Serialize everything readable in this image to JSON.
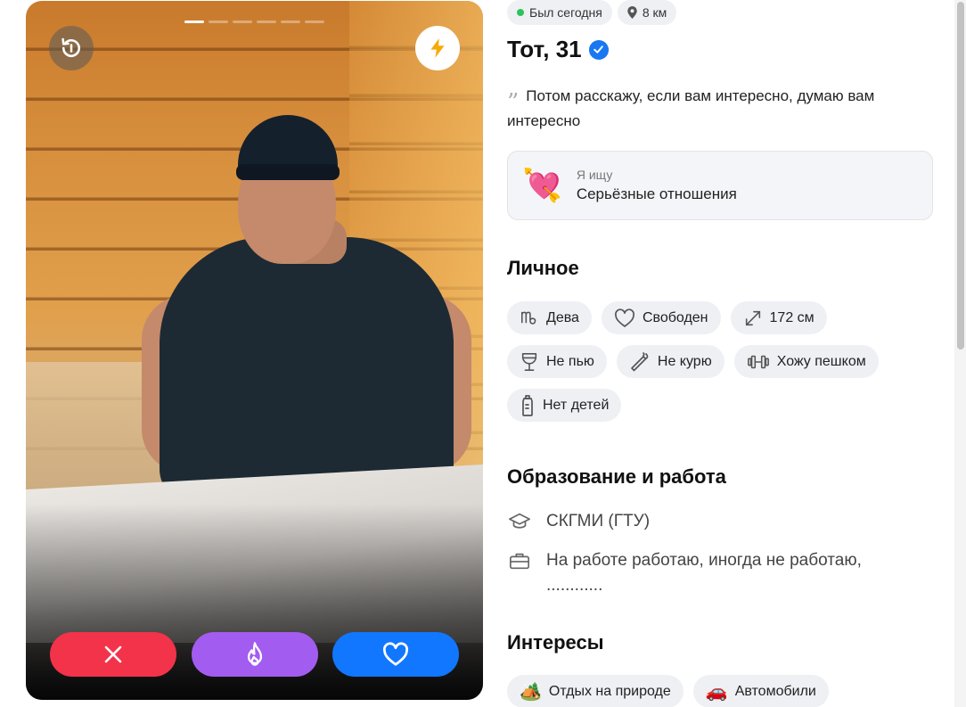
{
  "photo": {
    "dashes_total": 6,
    "dash_active_index": 0
  },
  "status": {
    "last_seen": "Был сегодня",
    "distance": "8 км"
  },
  "profile": {
    "name_age": "Тот, 31",
    "bio": "Потом расскажу, если вам интересно, думаю вам интересно",
    "quote_mark": "99"
  },
  "looking_for": {
    "emoji": "💘",
    "label": "Я ищу",
    "value": "Серьёзные отношения"
  },
  "personal": {
    "title": "Личное",
    "tags": [
      {
        "icon": "virgo-icon",
        "label": "Дева"
      },
      {
        "icon": "heart-outline-icon",
        "label": "Свободен"
      },
      {
        "icon": "height-arrows-icon",
        "label": "172 см"
      },
      {
        "icon": "wine-glass-icon",
        "label": "Не пью"
      },
      {
        "icon": "cigarette-icon",
        "label": "Не курю"
      },
      {
        "icon": "dumbbell-icon",
        "label": "Хожу пешком"
      },
      {
        "icon": "baby-bottle-icon",
        "label": "Нет детей"
      }
    ]
  },
  "education_work": {
    "title": "Образование и работа",
    "education": "СКГМИ (ГТУ)",
    "work": "На работе работаю, иногда не работаю, ............"
  },
  "interests": {
    "title": "Интересы",
    "tags": [
      {
        "emoji": "🏕️",
        "label": "Отдых на природе"
      },
      {
        "emoji": "🚗",
        "label": "Автомобили"
      }
    ]
  },
  "colors": {
    "dislike": "#f2334a",
    "superlike": "#a35cf0",
    "like": "#1177ff",
    "verified": "#1877f2",
    "online": "#2ec35a"
  }
}
